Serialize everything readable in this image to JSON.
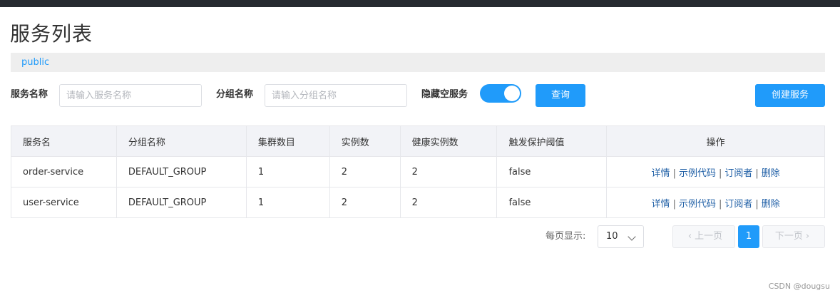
{
  "page": {
    "title": "服务列表"
  },
  "namespace": {
    "current": "public"
  },
  "filters": {
    "service_name_label": "服务名称",
    "service_name_placeholder": "请输入服务名称",
    "group_name_label": "分组名称",
    "group_name_placeholder": "请输入分组名称",
    "hide_empty_label": "隐藏空服务",
    "hide_empty_on": true,
    "query_label": "查询",
    "create_label": "创建服务"
  },
  "table": {
    "headers": [
      "服务名",
      "分组名称",
      "集群数目",
      "实例数",
      "健康实例数",
      "触发保护阈值",
      "操作"
    ],
    "rows": [
      {
        "service": "order-service",
        "group": "DEFAULT_GROUP",
        "clusters": "1",
        "instances": "2",
        "healthy": "2",
        "protect": "false"
      },
      {
        "service": "user-service",
        "group": "DEFAULT_GROUP",
        "clusters": "1",
        "instances": "2",
        "healthy": "2",
        "protect": "false"
      }
    ],
    "actions": {
      "detail": "详情",
      "sample_code": "示例代码",
      "subscribers": "订阅者",
      "delete": "删除",
      "separator": "|"
    }
  },
  "pagination": {
    "page_size_label": "每页显示:",
    "page_size": "10",
    "prev_label": "上一页",
    "next_label": "下一页",
    "current_page": "1"
  },
  "watermark": "CSDN @dougsu",
  "colors": {
    "accent": "#209bfa",
    "link": "#1f5fa6",
    "topbar": "#262a30"
  }
}
